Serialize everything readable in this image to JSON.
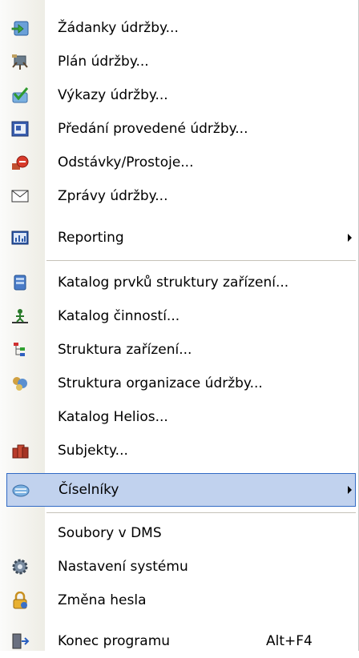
{
  "menu": {
    "items": [
      {
        "label": "Žádanky údržby...",
        "icon": "request-icon"
      },
      {
        "label": "Plán údržby...",
        "icon": "plan-icon"
      },
      {
        "label": "Výkazy údržby...",
        "icon": "report-check-icon"
      },
      {
        "label": "Předání provedené údržby...",
        "icon": "handover-icon"
      },
      {
        "label": "Odstávky/Prostoje...",
        "icon": "downtime-icon"
      },
      {
        "label": "Zprávy údržby...",
        "icon": "envelope-icon"
      },
      {
        "label": "Reporting",
        "icon": "chart-icon",
        "submenu": true
      },
      {
        "label": "Katalog prvků struktury zařízení...",
        "icon": "catalog-icon"
      },
      {
        "label": "Katalog činností...",
        "icon": "activity-icon"
      },
      {
        "label": "Struktura zařízení...",
        "icon": "tree-icon"
      },
      {
        "label": "Struktura organizace údržby...",
        "icon": "organization-icon"
      },
      {
        "label": "Katalog Helios...",
        "icon": ""
      },
      {
        "label": "Subjekty...",
        "icon": "subjects-icon"
      },
      {
        "label": "Číselníky",
        "icon": "codebook-icon",
        "submenu": true,
        "highlighted": true
      },
      {
        "label": "Soubory v DMS",
        "icon": ""
      },
      {
        "label": "Nastavení systému",
        "icon": "gear-icon"
      },
      {
        "label": "Změna hesla",
        "icon": "lock-icon"
      },
      {
        "label": "Konec programu",
        "icon": "exit-icon",
        "shortcut": "Alt+F4"
      }
    ]
  },
  "colors": {
    "highlight_bg": "#c1d2ee",
    "highlight_border": "#316ac5",
    "gutter": "#eeede5"
  }
}
